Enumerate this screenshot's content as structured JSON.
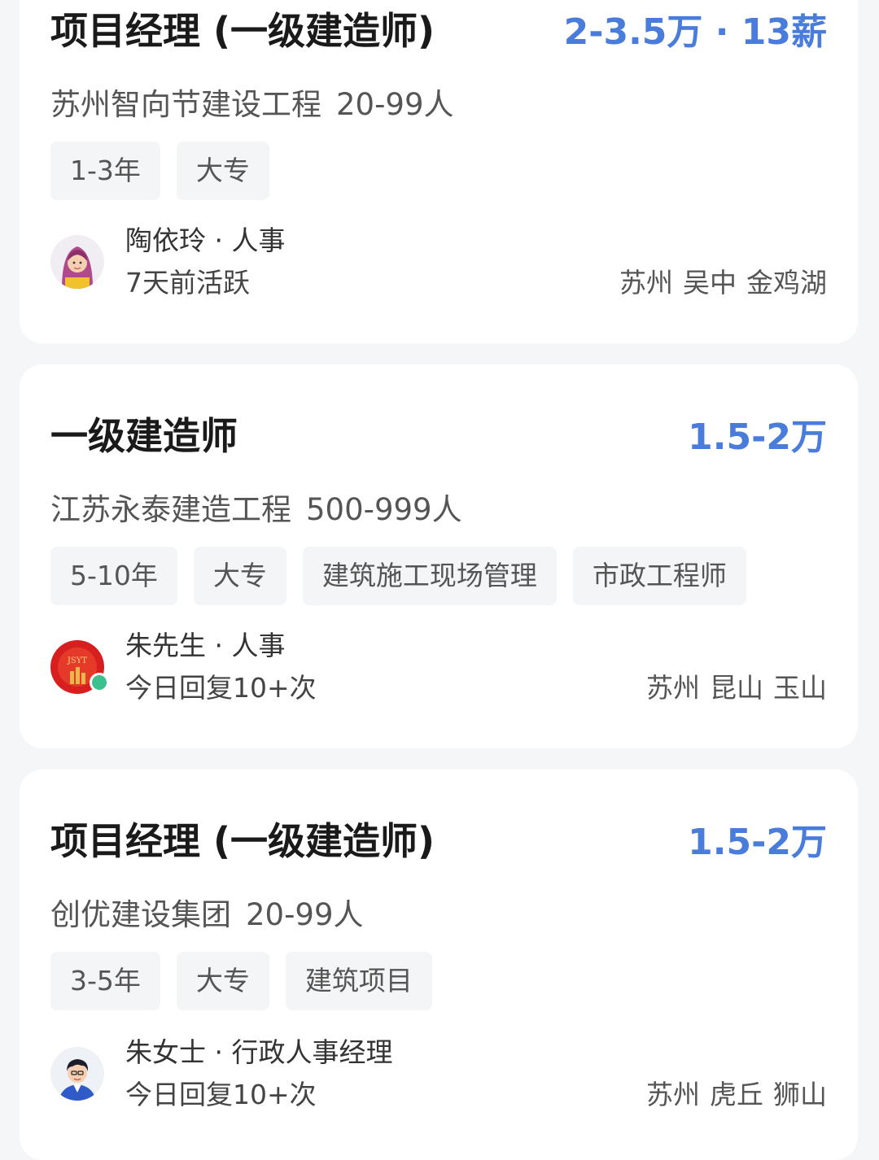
{
  "jobs": [
    {
      "title": "项目经理 (一级建造师)",
      "salary": "2-3.5万 · 13薪",
      "company": "苏州智向节建设工程",
      "size": "20-99人",
      "tags": [
        "1-3年",
        "大专"
      ],
      "recruiter": "陶依玲 · 人事",
      "status": "7天前活跃",
      "location": [
        "苏州",
        "吴中",
        "金鸡湖"
      ],
      "avatar_icon": "female-avatar-icon",
      "online": false
    },
    {
      "title": "一级建造师",
      "salary": "1.5-2万",
      "company": "江苏永泰建造工程",
      "size": "500-999人",
      "tags": [
        "5-10年",
        "大专",
        "建筑施工现场管理",
        "市政工程师"
      ],
      "recruiter": "朱先生 · 人事",
      "status": "今日回复10+次",
      "location": [
        "苏州",
        "昆山",
        "玉山"
      ],
      "avatar_icon": "company-logo-icon",
      "logo_text": "JSYT",
      "online": true
    },
    {
      "title": "项目经理 (一级建造师)",
      "salary": "1.5-2万",
      "company": "创优建设集团",
      "size": "20-99人",
      "tags": [
        "3-5年",
        "大专",
        "建筑项目"
      ],
      "recruiter": "朱女士 · 行政人事经理",
      "status": "今日回复10+次",
      "location": [
        "苏州",
        "虎丘",
        "狮山"
      ],
      "avatar_icon": "male-avatar-icon",
      "online": false
    }
  ],
  "colors": {
    "salary": "#4a7cdc",
    "online": "#3cc08e",
    "tag_bg": "#f4f5f7",
    "page_bg": "#f5f6f8"
  }
}
